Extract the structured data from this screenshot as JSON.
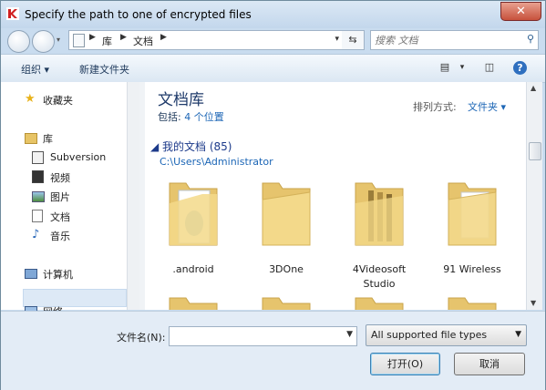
{
  "window": {
    "title": "Specify the path to one of encrypted files",
    "close_label": "✕"
  },
  "address": {
    "crumbs": [
      "库",
      "文档"
    ]
  },
  "search": {
    "placeholder": "搜索 文档"
  },
  "toolbar": {
    "organize": "组织 ▾",
    "new_folder": "新建文件夹"
  },
  "nav": {
    "favorites": "收藏夹",
    "libraries": "库",
    "items": [
      "Subversion",
      "视频",
      "图片",
      "文档",
      "音乐"
    ],
    "computer": "计算机",
    "network": "网络"
  },
  "library": {
    "title": "文档库",
    "includes_label": "包括:",
    "includes_value": "4 个位置",
    "arrange_label": "排列方式:",
    "arrange_value": "文件夹 ▾",
    "group_header": "◢ 我的文档 (85)",
    "group_path": "C:\\Users\\Administrator"
  },
  "folders": [
    {
      "name": ".android"
    },
    {
      "name": "3DOne"
    },
    {
      "name": "4Videosoft\nStudio"
    },
    {
      "name": "91 Wireless"
    }
  ],
  "footer": {
    "filename_label": "文件名(N):",
    "filename_value": "",
    "filetype_value": "All supported file types",
    "open_label": "打开(O)",
    "cancel_label": "取消"
  },
  "colors": {
    "accent": "#1c66b6",
    "folder": "#f3d98a"
  }
}
